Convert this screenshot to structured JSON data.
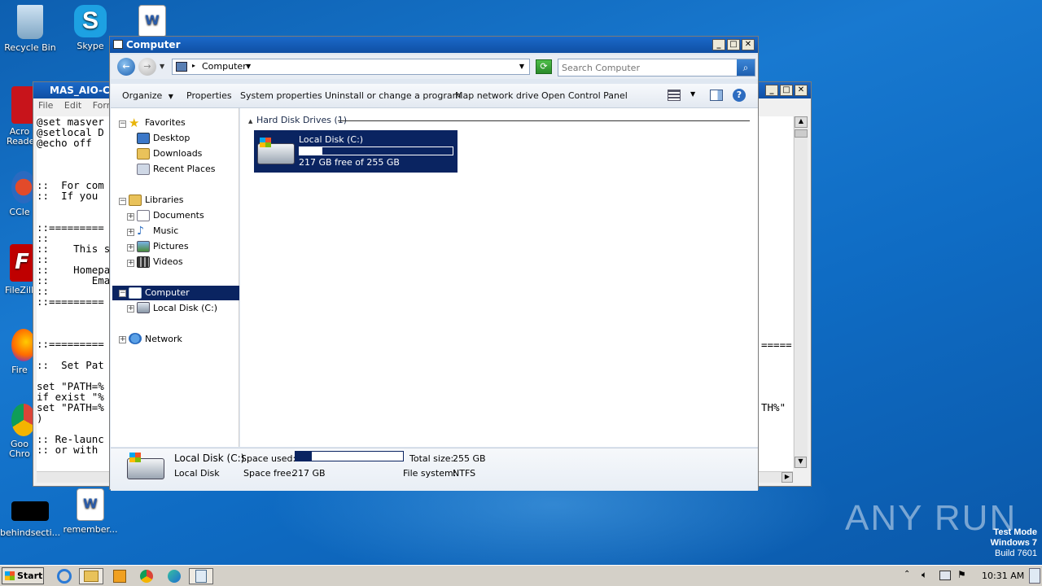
{
  "desktop": {
    "icons": {
      "recycle_bin": "Recycle Bin",
      "skype": "Skype",
      "acrobat": "Acro\nReade",
      "ccleaner": "CCle",
      "filezilla": "FileZilla",
      "firefox": "Fire",
      "chrome": "Goo\nChro",
      "behindsection": "behindsecti...",
      "remember": "remember..."
    },
    "watermark": {
      "brand": "ANY RUN",
      "line1": "Test Mode",
      "line2": "Windows 7",
      "line3": "Build 7601"
    }
  },
  "notepad": {
    "title": "MAS_AIO-CR",
    "menu": [
      "File",
      "Edit",
      "Forma"
    ],
    "lines": [
      "@set masver",
      "@setlocal D",
      "@echo off",
      "",
      "",
      "",
      "::  For com",
      "::  If you",
      "",
      "",
      "::=========",
      "::",
      "::    This s",
      "::",
      "::    Homepa",
      "::       Ema",
      "::",
      "::=========",
      "",
      "",
      "",
      "::=========",
      "",
      "::  Set Pat",
      "",
      "set \"PATH=%",
      "if exist \"%",
      "set \"PATH=%",
      ")",
      "",
      ":: Re-launc",
      ":: or with"
    ],
    "right_fragment": "TH%\"",
    "right_divider": "====="
  },
  "explorer": {
    "title": "Computer",
    "breadcrumb": "Computer",
    "search_placeholder": "Search Computer",
    "toolbar": {
      "organize": "Organize",
      "properties": "Properties",
      "system_properties": "System properties",
      "uninstall": "Uninstall or change a program",
      "map_drive": "Map network drive",
      "control_panel": "Open Control Panel"
    },
    "nav": {
      "favorites": "Favorites",
      "desktop": "Desktop",
      "downloads": "Downloads",
      "recent": "Recent Places",
      "libraries": "Libraries",
      "documents": "Documents",
      "music": "Music",
      "pictures": "Pictures",
      "videos": "Videos",
      "computer": "Computer",
      "local_disk": "Local Disk (C:)",
      "network": "Network"
    },
    "group_header": "Hard Disk Drives (1)",
    "drive": {
      "name": "Local Disk (C:)",
      "free_text": "217 GB free of 255 GB",
      "used_fraction": 0.15
    },
    "details": {
      "name": "Local Disk (C:)",
      "type": "Local Disk",
      "space_used_label": "Space used:",
      "space_free_label": "Space free:",
      "space_free": "217 GB",
      "total_size_label": "Total size:",
      "total_size": "255 GB",
      "fs_label": "File system:",
      "fs": "NTFS"
    }
  },
  "taskbar": {
    "start": "Start",
    "clock": "10:31 AM"
  },
  "colors": {
    "selection": "#0a2461",
    "titlebar": "#1b6ac9"
  }
}
